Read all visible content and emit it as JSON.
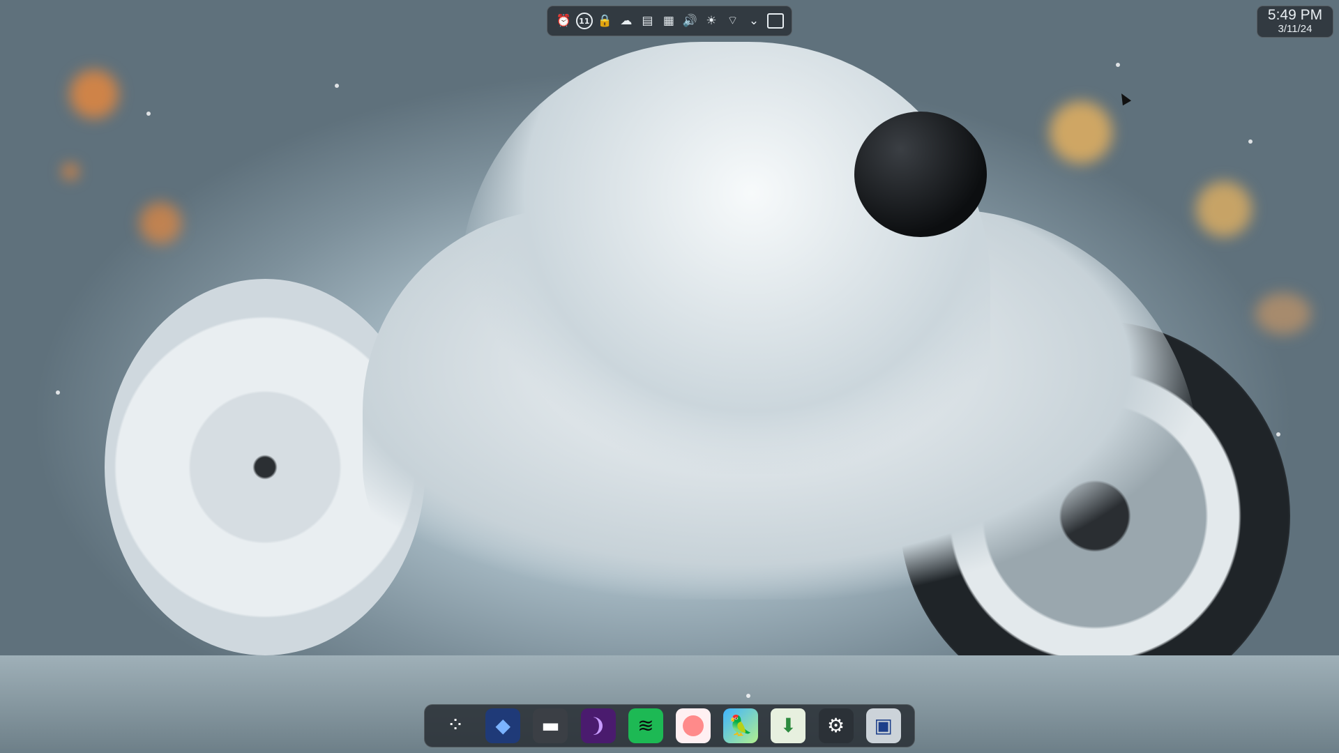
{
  "topbar": {
    "icons": [
      {
        "name": "alarm-icon",
        "glyph": "⏰"
      },
      {
        "name": "notifications-badge-icon",
        "glyph": "11"
      },
      {
        "name": "lock-icon",
        "glyph": "🔒"
      },
      {
        "name": "cloud-icon",
        "glyph": "☁"
      },
      {
        "name": "clipboard-icon",
        "glyph": "▤"
      },
      {
        "name": "storage-icon",
        "glyph": "▦"
      },
      {
        "name": "volume-icon",
        "glyph": "🔊"
      },
      {
        "name": "brightness-icon",
        "glyph": "☀"
      },
      {
        "name": "network-icon",
        "glyph": "⌔"
      },
      {
        "name": "chevron-down-icon",
        "glyph": "⌄"
      },
      {
        "name": "show-desktop-icon",
        "glyph": ""
      }
    ]
  },
  "clock": {
    "time": "5:49 PM",
    "date": "3/11/24"
  },
  "dock": {
    "items": [
      {
        "name": "app-launcher-icon",
        "glyph": "⁘"
      },
      {
        "name": "browser-icon",
        "glyph": "◆"
      },
      {
        "name": "file-manager-icon",
        "glyph": "▬"
      },
      {
        "name": "podcast-icon",
        "glyph": "❩"
      },
      {
        "name": "spotify-icon",
        "glyph": "≋"
      },
      {
        "name": "pink-circle-app-icon",
        "glyph": ""
      },
      {
        "name": "parrot-app-icon",
        "glyph": "🦜"
      },
      {
        "name": "download-manager-icon",
        "glyph": "⬇"
      },
      {
        "name": "settings-icon",
        "glyph": "⚙"
      },
      {
        "name": "vault-app-icon",
        "glyph": "▣"
      }
    ]
  }
}
